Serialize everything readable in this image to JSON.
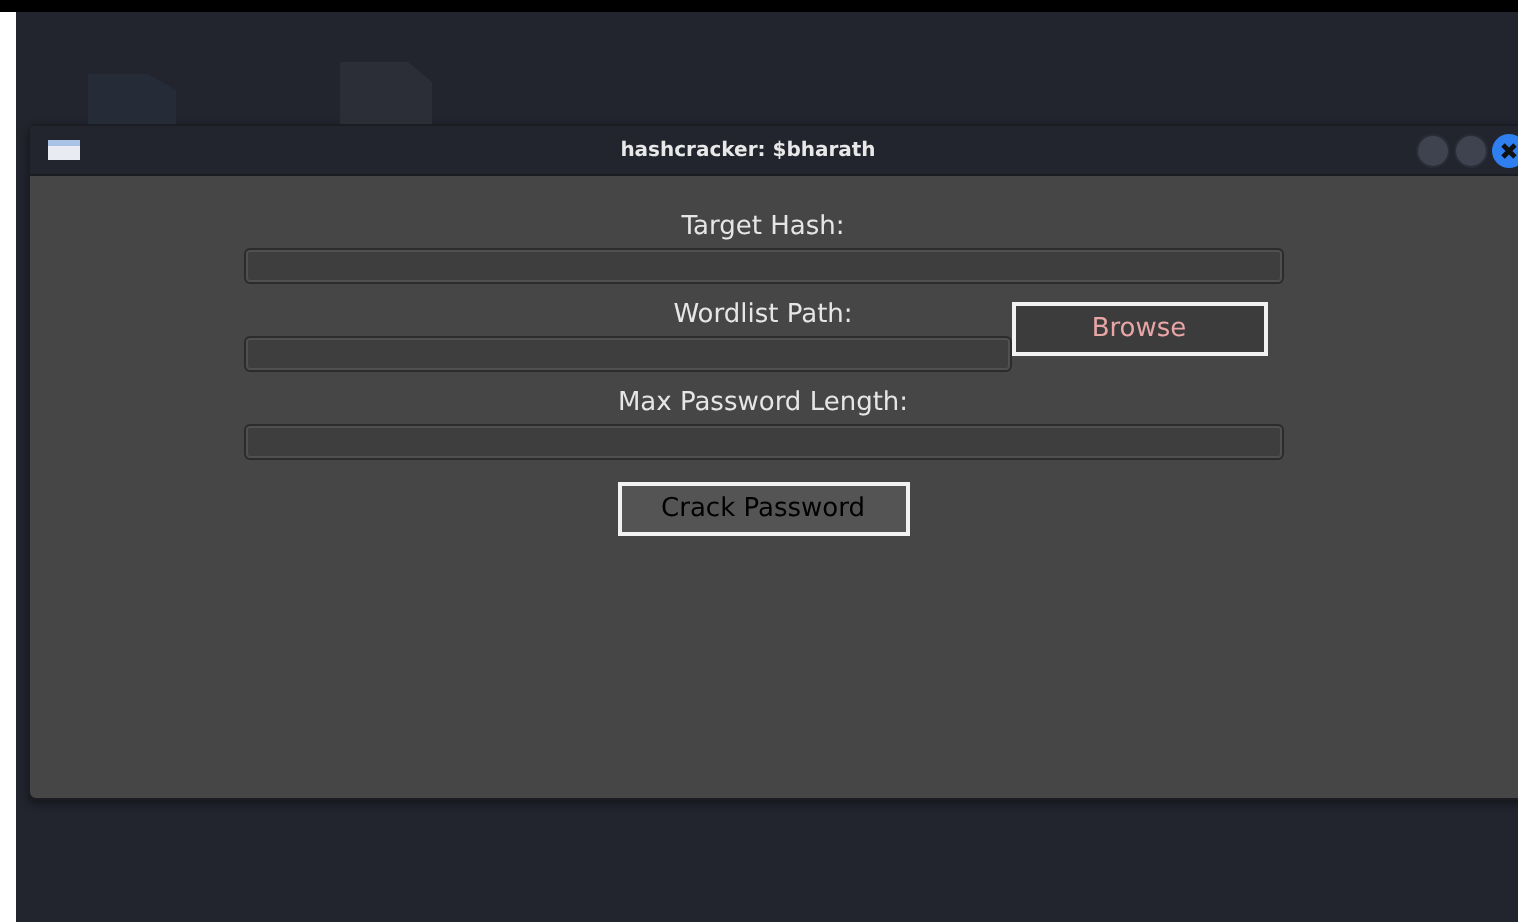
{
  "window": {
    "title": "hashcracker: $bharath"
  },
  "fields": [
    {
      "label": "Target Hash:"
    },
    {
      "label": "Wordlist Path:",
      "button": "Browse"
    },
    {
      "label": "Max Password Length:"
    }
  ],
  "action_button": "Crack Password"
}
